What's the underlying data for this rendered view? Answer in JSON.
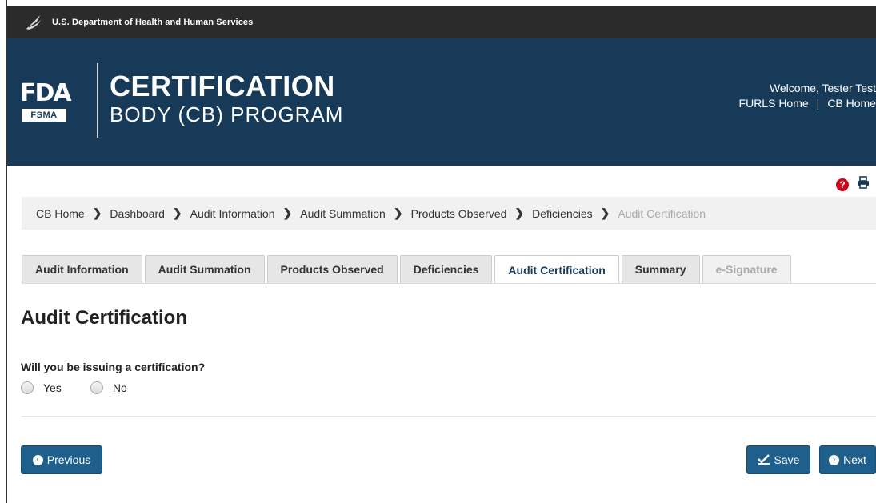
{
  "agency_bar": {
    "text": "U.S. Department of Health and Human Services"
  },
  "banner": {
    "logo_letters": "FDA",
    "logo_badge": "FSMA",
    "title_line1": "CERTIFICATION",
    "title_line2": "BODY (CB) PROGRAM",
    "welcome": "Welcome, Tester Test",
    "links": [
      "FURLS Home",
      "CB Home"
    ]
  },
  "tools": {
    "help_icon": "question-circle-icon",
    "print_icon": "print-icon"
  },
  "breadcrumb": {
    "items": [
      "CB Home",
      "Dashboard",
      "Audit Information",
      "Audit Summation",
      "Products Observed",
      "Deficiencies"
    ],
    "current": "Audit Certification"
  },
  "tabs": [
    {
      "label": "Audit Information",
      "state": "normal"
    },
    {
      "label": "Audit Summation",
      "state": "normal"
    },
    {
      "label": "Products Observed",
      "state": "normal"
    },
    {
      "label": "Deficiencies",
      "state": "normal"
    },
    {
      "label": "Audit Certification",
      "state": "active"
    },
    {
      "label": "Summary",
      "state": "normal"
    },
    {
      "label": "e-Signature",
      "state": "disabled"
    }
  ],
  "main": {
    "title": "Audit Certification",
    "question": "Will you be issuing a certification?",
    "options": [
      "Yes",
      "No"
    ]
  },
  "buttons": {
    "previous": "Previous",
    "save": "Save",
    "next": "Next"
  },
  "colors": {
    "header_bg": "#173a58",
    "agency_bar_bg": "#2b2b2b",
    "button_bg": "#1f5f8b",
    "help_red": "#d0021b"
  }
}
